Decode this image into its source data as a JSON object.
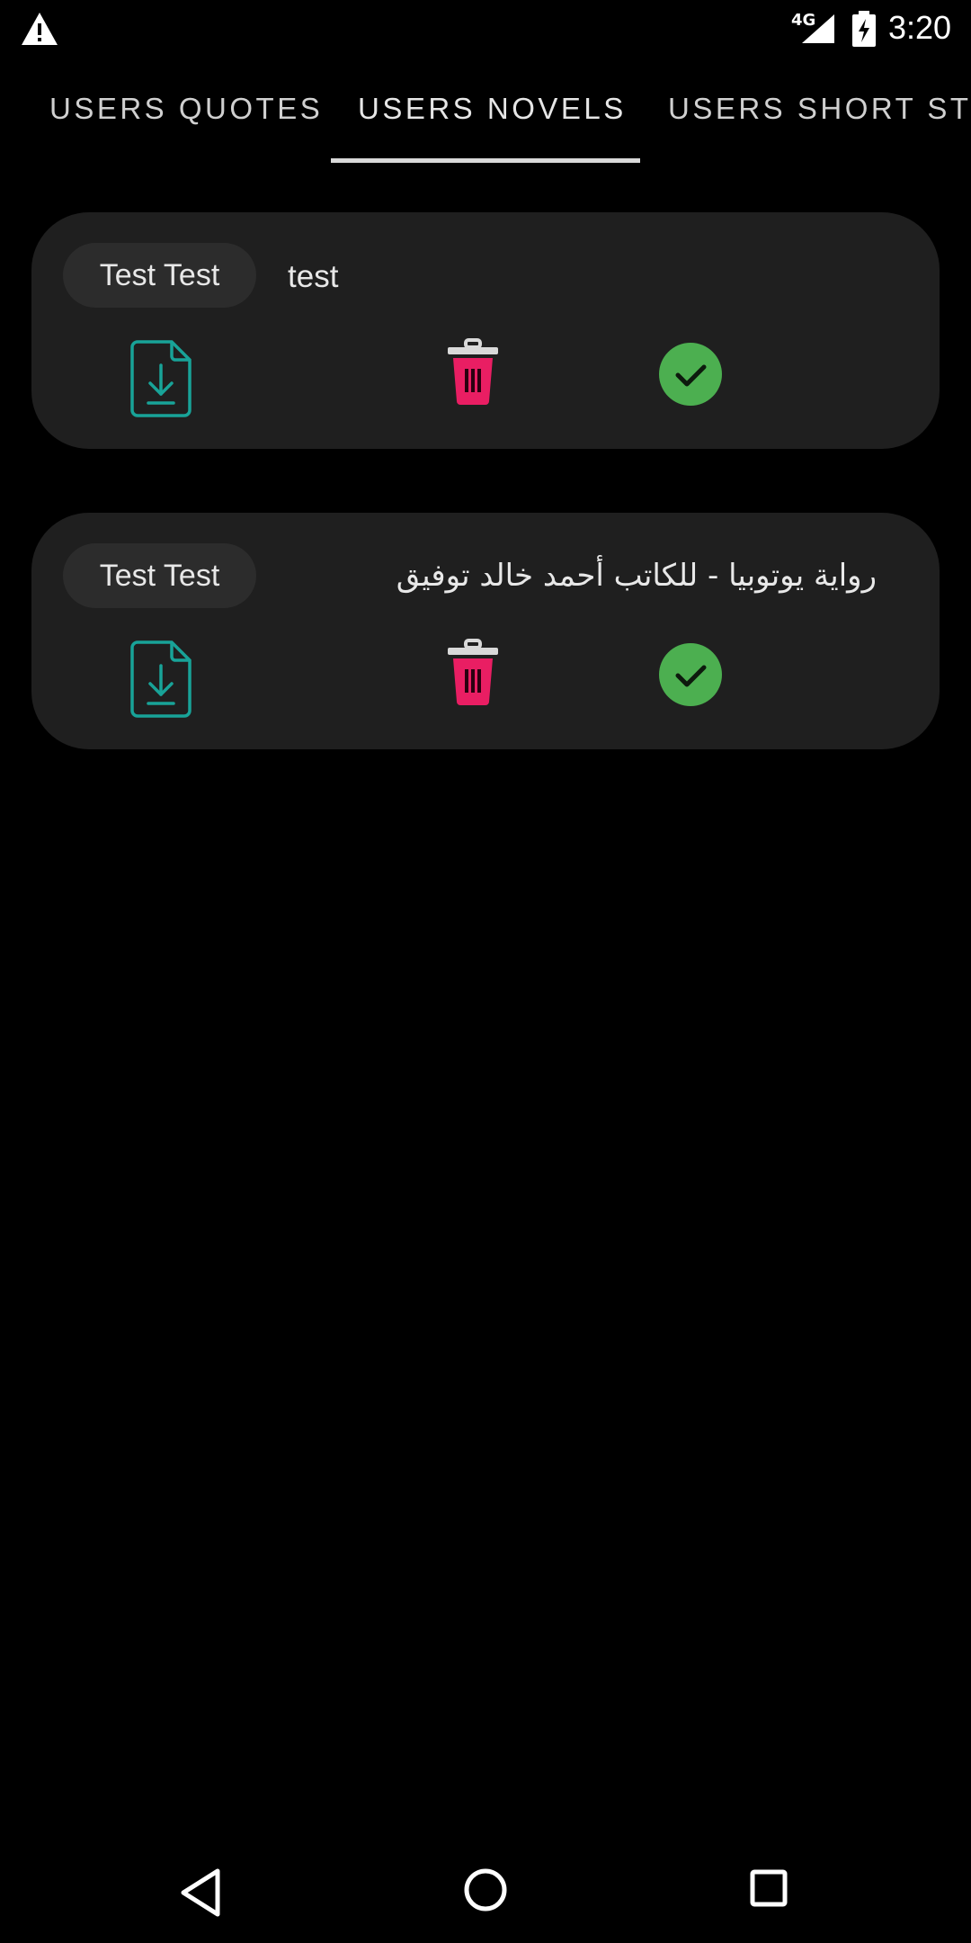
{
  "status_bar": {
    "network": "4G",
    "time": "3:20",
    "icons": [
      "warning-icon",
      "signal-icon",
      "battery-charging-icon"
    ]
  },
  "tabs": [
    {
      "label": "USERS QUOTES",
      "selected": false
    },
    {
      "label": "USERS NOVELS",
      "selected": true
    },
    {
      "label": "USERS SHORT STO",
      "selected": false
    }
  ],
  "cards": [
    {
      "author": "Test Test",
      "title": "test",
      "title_dir": "ltr",
      "actions": [
        "download-file-icon",
        "delete-icon",
        "approve-check-icon"
      ]
    },
    {
      "author": "Test Test",
      "title": "رواية يوتوبيا - للكاتب أحمد خالد توفيق",
      "title_dir": "rtl",
      "actions": [
        "download-file-icon",
        "delete-icon",
        "approve-check-icon"
      ]
    }
  ],
  "colors": {
    "background": "#000000",
    "card": "#1f1f1f",
    "chip": "#2c2c2c",
    "download": "#18a398",
    "delete": "#e91e63",
    "approve": "#4caf50"
  },
  "nav_bar": {
    "icons": [
      "back-icon",
      "home-icon",
      "recents-icon"
    ]
  }
}
